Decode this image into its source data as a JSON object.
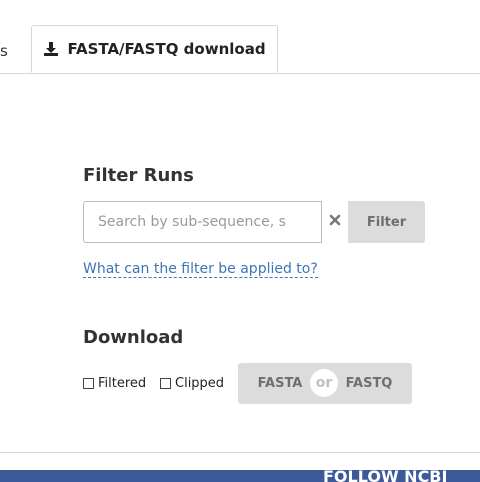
{
  "tabs": {
    "partial_label": "s",
    "active_label": "FASTA/FASTQ download",
    "active_icon": "download-icon"
  },
  "filter": {
    "title": "Filter Runs",
    "search_placeholder": "Search by sub-sequence, s",
    "search_value": "",
    "clear_icon": "close-icon",
    "filter_button": "Filter",
    "help_link": "What can the filter be applied to?"
  },
  "download": {
    "title": "Download",
    "options": [
      {
        "label": "Filtered",
        "checked": false
      },
      {
        "label": "Clipped",
        "checked": false
      }
    ],
    "formats": {
      "fasta": "FASTA",
      "or": "or",
      "fastq": "FASTQ"
    }
  },
  "footer": {
    "text": "FOLLOW NCBI"
  },
  "colors": {
    "link": "#3a76b8",
    "button_bg": "#dcdcdc",
    "footer_bg": "#3c5a9a"
  }
}
